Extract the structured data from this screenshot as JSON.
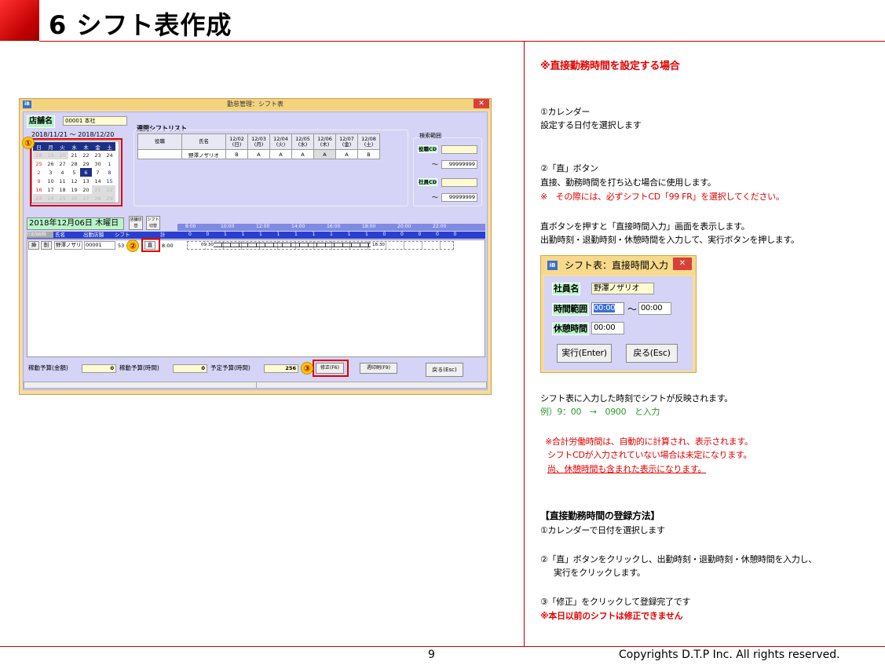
{
  "page": {
    "title": "6 シフト表作成",
    "page_number": "9",
    "copyright": "Copyrights D.T.P Inc. All rights reserved."
  },
  "screenshot": {
    "window_title": "勤怠管理：シフト表",
    "store_label": "店舗名",
    "store_value": "00001 本社",
    "date_range": "2018/11/21 ～ 2018/12/20",
    "calendar_head": [
      "日",
      "月",
      "火",
      "水",
      "木",
      "金",
      "土"
    ],
    "calendar_rows": [
      [
        "18",
        "19",
        "20",
        "21",
        "22",
        "23",
        "24"
      ],
      [
        "25",
        "26",
        "27",
        "28",
        "29",
        "30",
        "1"
      ],
      [
        "2",
        "3",
        "4",
        "5",
        "6",
        "7",
        "8"
      ],
      [
        "9",
        "10",
        "11",
        "12",
        "13",
        "14",
        "15"
      ],
      [
        "16",
        "17",
        "18",
        "19",
        "20",
        "21",
        "22"
      ],
      [
        "23",
        "24",
        "25",
        "26",
        "27",
        "28",
        "29"
      ]
    ],
    "weekly_list_title": "週間シフトリスト",
    "weekly_headers": [
      "役職",
      "氏名",
      "12/02 (日)",
      "12/03 (月)",
      "12/04 (火)",
      "12/05 (水)",
      "12/06 (木)",
      "12/07 (金)",
      "12/08 (土)"
    ],
    "weekly_row": [
      "",
      "野澤ノザリオ",
      "B",
      "A",
      "A",
      "A",
      "A",
      "A",
      "B"
    ],
    "search_title": "検索範囲",
    "search_post_label": "役職CD",
    "search_emp_label": "社員CD",
    "search_tilde": "～",
    "search_max": "99999999",
    "current_date": "2018年12月06日 木曜日",
    "btn_store_switch": "店舗切替",
    "btn_shift_switch": "シフト切替",
    "timeline_hours": [
      "8:00",
      "10:00",
      "12:00",
      "14:00",
      "16:00",
      "18:00",
      "20:00",
      "22:00"
    ],
    "timeline_counts": [
      "0",
      "0",
      "1",
      "1",
      "1",
      "1",
      "1",
      "1",
      "1",
      "1",
      "1",
      "0",
      "0",
      "0",
      "0",
      "0"
    ],
    "list_headers": [
      "行追加削除",
      "氏名",
      "出勤店舗",
      "シフト",
      "計"
    ],
    "row_ins": "挿",
    "row_del": "削",
    "row_name": "野澤ノザリ",
    "row_store": "00001",
    "row_shift": "53",
    "row_direct": "直",
    "row_total": "8:00",
    "row_start": "09:30",
    "row_end": "18:30",
    "budget_amount_label": "稼動予算(金額)",
    "budget_amount": "0",
    "budget_time_label": "稼動予算(時間)",
    "budget_time": "0",
    "plan_time_label": "予定予算(時間)",
    "plan_time": "256",
    "btn_fix": "修正(F6)",
    "btn_print": "週印刷(F9)",
    "btn_back": "戻る(Esc)"
  },
  "circles": [
    "①",
    "②",
    "③"
  ],
  "right": {
    "heading": "※直接勤務時間を設定する場合",
    "s1_title": "①カレンダー",
    "s1_text": "設定する日付を選択します",
    "s2_title": "②「直」ボタン",
    "s2_text": "直接、勤務時間を打ち込む場合に使用します。",
    "s2_note": "※　その際には、必ずシフトCD「99 FR」を選択してください。",
    "s2_p1": "直ボタンを押すと「直接時間入力」画面を表示します。",
    "s2_p2": "出勤時刻・退勤時刻・休憩時間を入力して、実行ボタンを押します。",
    "after1": "シフト表に入力した時刻でシフトが反映されます。",
    "after2": "例）9：00　→　0900　と入力",
    "note1": "※合計労働時間は、自動的に計算され、表示されます。",
    "note2": "シフトCDが入力されていない場合は未定になります。",
    "note3": "尚、休憩時間も含まれた表示になります。",
    "how_title": "【直接勤務時間の登録方法】",
    "how1": "①カレンダーで日付を選択します",
    "how2a": "②「直」ボタンをクリックし、出勤時刻・退勤時刻・休憩時間を入力し、",
    "how2b": "実行をクリックします。",
    "how3": "③「修正」をクリックして登録完了です",
    "how_warn": "※本日以前のシフトは修正できません"
  },
  "dialog": {
    "title": "シフト表：直接時間入力",
    "emp_label": "社員名",
    "emp_value": "野澤ノザリオ",
    "range_label": "時間範囲",
    "range_from": "00:00",
    "range_tilde": "～",
    "range_to": "00:00",
    "break_label": "休憩時間",
    "break_value": "00:00",
    "btn_exec": "実行(Enter)",
    "btn_back": "戻る(Esc)"
  }
}
